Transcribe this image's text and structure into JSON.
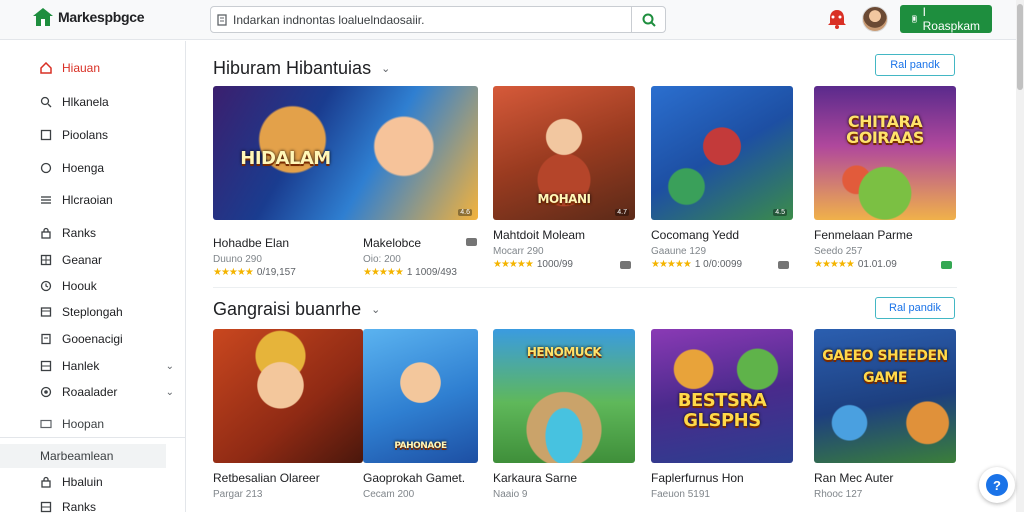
{
  "app": {
    "logo_text": "Markespbgce",
    "brand_color": "#1e8e3e",
    "accent_color": "#d93025"
  },
  "search": {
    "placeholder": "",
    "value": "Indarkan indnontas loaluelndaosaiir."
  },
  "header": {
    "cta_label": "I Roaspkam",
    "icons": [
      "search-icon",
      "notification-icon",
      "avatar"
    ]
  },
  "sidebar": {
    "items": [
      {
        "label": "Hiauan",
        "icon": "home-icon",
        "active": true
      },
      {
        "label": "Hlkanela",
        "icon": "search-icon"
      },
      {
        "label": "Pioolans",
        "icon": "square-icon"
      },
      {
        "label": "Hoenga",
        "icon": "circle-icon"
      },
      {
        "label": "Hlcraoian",
        "icon": "list-icon"
      },
      {
        "label": "Ranks",
        "icon": "lock-icon"
      },
      {
        "label": "Geanar",
        "icon": "grid-icon"
      },
      {
        "label": "Hoouk",
        "icon": "clock-icon"
      },
      {
        "label": "Steplongah",
        "icon": "box-icon"
      },
      {
        "label": "Gooenacigi",
        "icon": "doc-icon"
      },
      {
        "label": "Hanlek",
        "icon": "grid-icon",
        "expandable": true
      },
      {
        "label": "Roaalader",
        "icon": "target-icon",
        "expandable": true
      },
      {
        "label": "Hoopan",
        "icon": "card-icon"
      }
    ],
    "section_label": "Marbeamlean",
    "bottom_items": [
      {
        "label": "Hbaluin",
        "icon": "lock-icon"
      },
      {
        "label": "Ranks",
        "icon": "grid-icon"
      }
    ]
  },
  "sections": [
    {
      "title": "Hiburam Hibantuias",
      "button_label": "Ral pandk",
      "cards": [
        {
          "title": "Hohadbe Elan",
          "meta": "Duuno 290",
          "stars": "★★★★★",
          "count": "0/19,157",
          "thumb_text": "HIDALAM",
          "badge": "gray"
        },
        {
          "title": "Makelobce",
          "meta": "Oio: 200",
          "stars": "★★★★★",
          "count": "1 1009/493",
          "thumb_text": "",
          "badge": "gray"
        },
        {
          "title": "Mahtdoit Moleam",
          "meta": "Mocarr 290",
          "stars": "★★★★★",
          "count": "1000/99",
          "thumb_text": "MOHANI",
          "badge": "gray"
        },
        {
          "title": "Cocomang Yedd",
          "meta": "Gaaune 129",
          "stars": "★★★★★",
          "count": "1 0/0:0099",
          "thumb_text": "",
          "badge": "gray"
        },
        {
          "title": "Fenmelaan Parme",
          "meta": "Seedo 257",
          "stars": "★★★★★",
          "count": "01.01.09",
          "thumb_text": "CHITARA GOIRAAS",
          "badge": "green"
        }
      ]
    },
    {
      "title": "Gangraisi buanrhe",
      "button_label": "Ral pandik",
      "cards": [
        {
          "title": "Retbesalian Olareer",
          "meta": "Pargar 213",
          "thumb_text": ""
        },
        {
          "title": "Gaoprokah Gamet.",
          "meta": "Cecam 200",
          "thumb_text": "PAHONAOE"
        },
        {
          "title": "Karkaura Sarne",
          "meta": "Naaio 9",
          "thumb_text": "HENOMUCK"
        },
        {
          "title": "Faplerfurnus Hon",
          "meta": "Faeuon 5191",
          "thumb_text": "BESTSRA GLSPHS"
        },
        {
          "title": "Ran Mec Auter",
          "meta": "Rhooc 127",
          "thumb_text": "GAEEO SHEEDEN GAME"
        }
      ]
    }
  ]
}
